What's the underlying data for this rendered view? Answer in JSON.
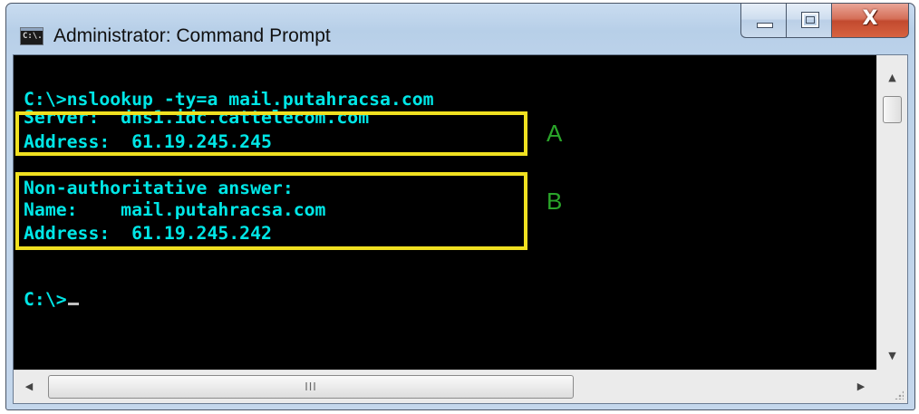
{
  "window": {
    "title": "Administrator: Command Prompt",
    "icon_name": "cmd-icon",
    "icon_text": "C:\\.",
    "controls": {
      "minimize": "minimize-icon",
      "maximize": "maximize-icon",
      "close_glyph": "X"
    }
  },
  "console": {
    "lines": [
      "C:\\>nslookup -ty=a mail.putahracsa.com",
      "Server:  dns1.idc.cattelecom.com",
      "Address:  61.19.245.245",
      "",
      "Non-authoritative answer:",
      "Name:    mail.putahracsa.com",
      "Address:  61.19.245.242",
      "",
      "C:\\>"
    ],
    "text_color": "#00e6e6",
    "background": "#000000"
  },
  "annotations": {
    "box_color": "#f0e020",
    "label_color": "#2aa52a",
    "labels": [
      "A",
      "B"
    ]
  },
  "scrollbars": {
    "horizontal_grip": "III"
  }
}
